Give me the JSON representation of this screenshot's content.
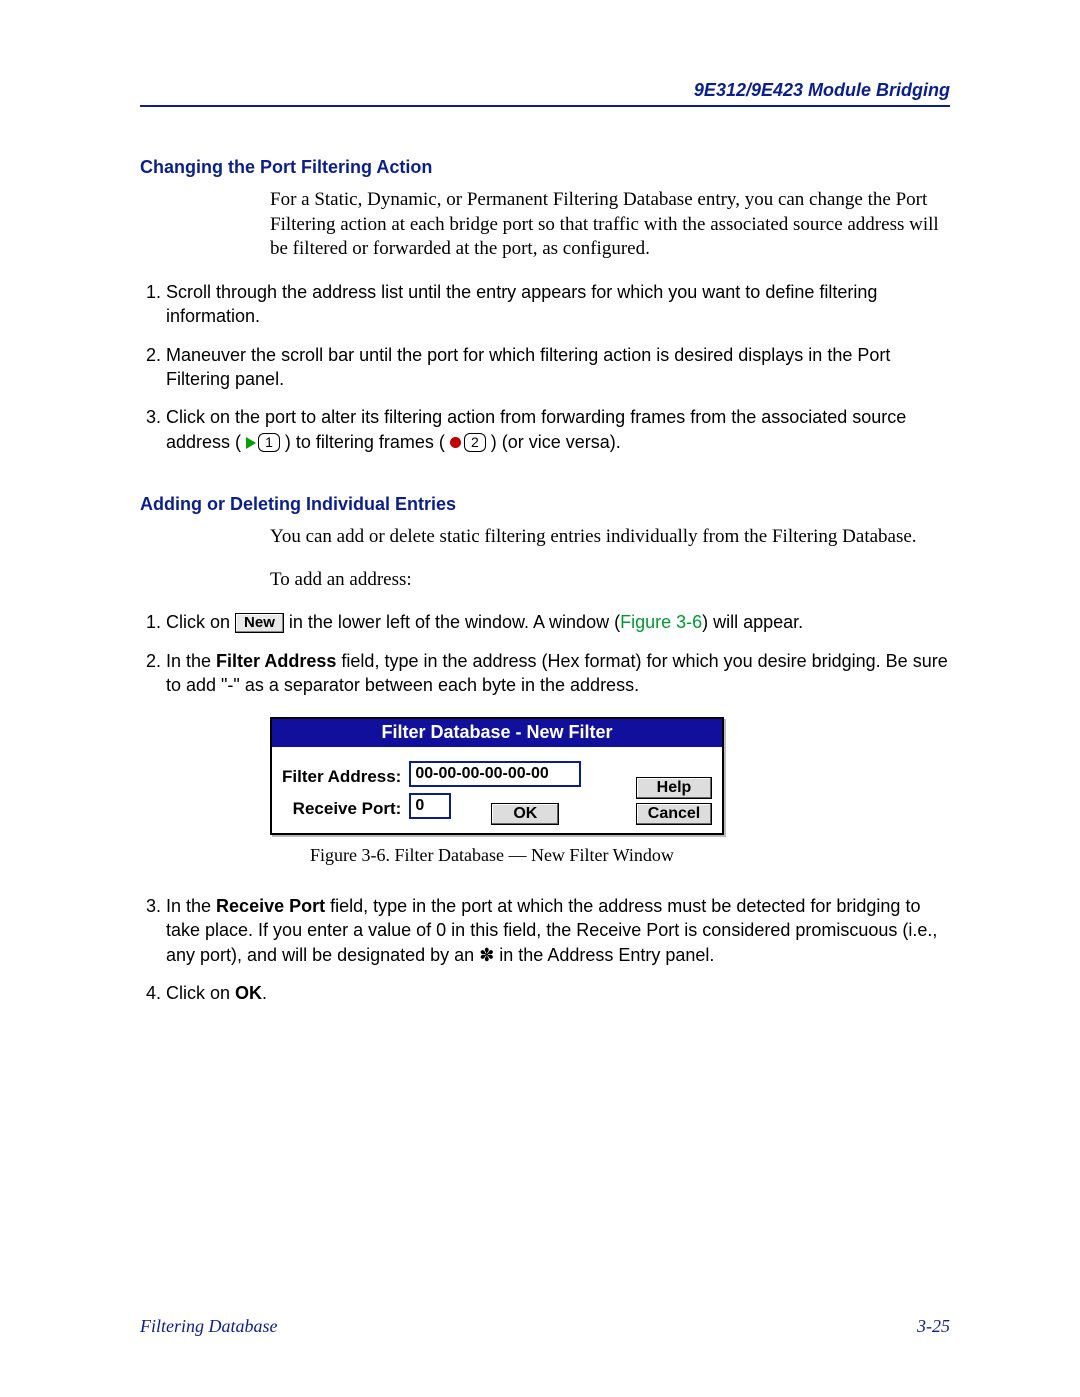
{
  "header": {
    "title": "9E312/9E423 Module Bridging"
  },
  "section1": {
    "heading": "Changing the Port Filtering Action",
    "intro": "For a Static, Dynamic, or Permanent Filtering Database entry, you can change the Port Filtering action at each bridge port so that traffic with the associated source address will be filtered or forwarded at the port, as configured.",
    "steps": {
      "s1": "Scroll through the address list until the entry appears for which you want to define filtering information.",
      "s2": "Maneuver the scroll bar until the port for which filtering action is desired displays in the Port Filtering panel.",
      "s3_a": "Click on the port to alter its filtering action from forwarding frames from the associated source address (",
      "s3_icon1_num": "1",
      "s3_b": ") to filtering frames (",
      "s3_icon2_num": "2",
      "s3_c": ") (or vice versa)."
    }
  },
  "section2": {
    "heading": "Adding or Deleting Individual Entries",
    "p1": "You can add or delete static filtering entries individually from the Filtering Database.",
    "p2": "To add an address:",
    "steps1": {
      "s1_a": "Click on ",
      "s1_btn": "New",
      "s1_b": " in the lower left of the window. A window (",
      "s1_ref": "Figure 3-6",
      "s1_c": ") will appear.",
      "s2_a": "In the ",
      "s2_bold": "Filter Address",
      "s2_b": " field, type in the address (Hex format) for which you desire bridging. Be sure to add \"-\" as a separator between each byte in the address."
    },
    "dialog": {
      "title": "Filter Database - New Filter",
      "filter_addr_label": "Filter Address:",
      "filter_addr_value": "00-00-00-00-00-00",
      "receive_port_label": "Receive Port:",
      "receive_port_value": "0",
      "help": "Help",
      "ok": "OK",
      "cancel": "Cancel"
    },
    "fig_caption": "Figure 3-6.  Filter Database — New Filter Window",
    "steps2": {
      "s3_a": "In the ",
      "s3_bold": "Receive Port",
      "s3_b": " field, type in the port at which the address must be detected for bridging to take place. If you enter a value of 0 in this field, the Receive Port is considered promiscuous (i.e., any port), and will be designated by an ✽ in the Address Entry panel.",
      "s4_a": "Click on ",
      "s4_bold": "OK",
      "s4_b": "."
    }
  },
  "footer": {
    "left": "Filtering Database",
    "right": "3-25"
  }
}
